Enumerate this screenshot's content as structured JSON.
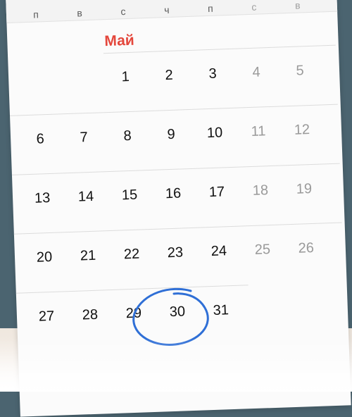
{
  "calendar": {
    "weekdays": [
      {
        "label": "п",
        "weekend": false
      },
      {
        "label": "в",
        "weekend": false
      },
      {
        "label": "с",
        "weekend": false
      },
      {
        "label": "ч",
        "weekend": false
      },
      {
        "label": "п",
        "weekend": false
      },
      {
        "label": "с",
        "weekend": true
      },
      {
        "label": "в",
        "weekend": true
      }
    ],
    "month": "Май",
    "weeks": [
      [
        null,
        null,
        "1",
        "2",
        "3",
        "4",
        "5"
      ],
      [
        "6",
        "7",
        "8",
        "9",
        "10",
        "11",
        "12"
      ],
      [
        "13",
        "14",
        "15",
        "16",
        "17",
        "18",
        "19"
      ],
      [
        "20",
        "21",
        "22",
        "23",
        "24",
        "25",
        "26"
      ],
      [
        "27",
        "28",
        "29",
        "30",
        "31",
        null,
        null
      ]
    ],
    "highlighted_day": "30",
    "accent_color": "#e4473c",
    "circle_color": "#2f6fd6"
  }
}
